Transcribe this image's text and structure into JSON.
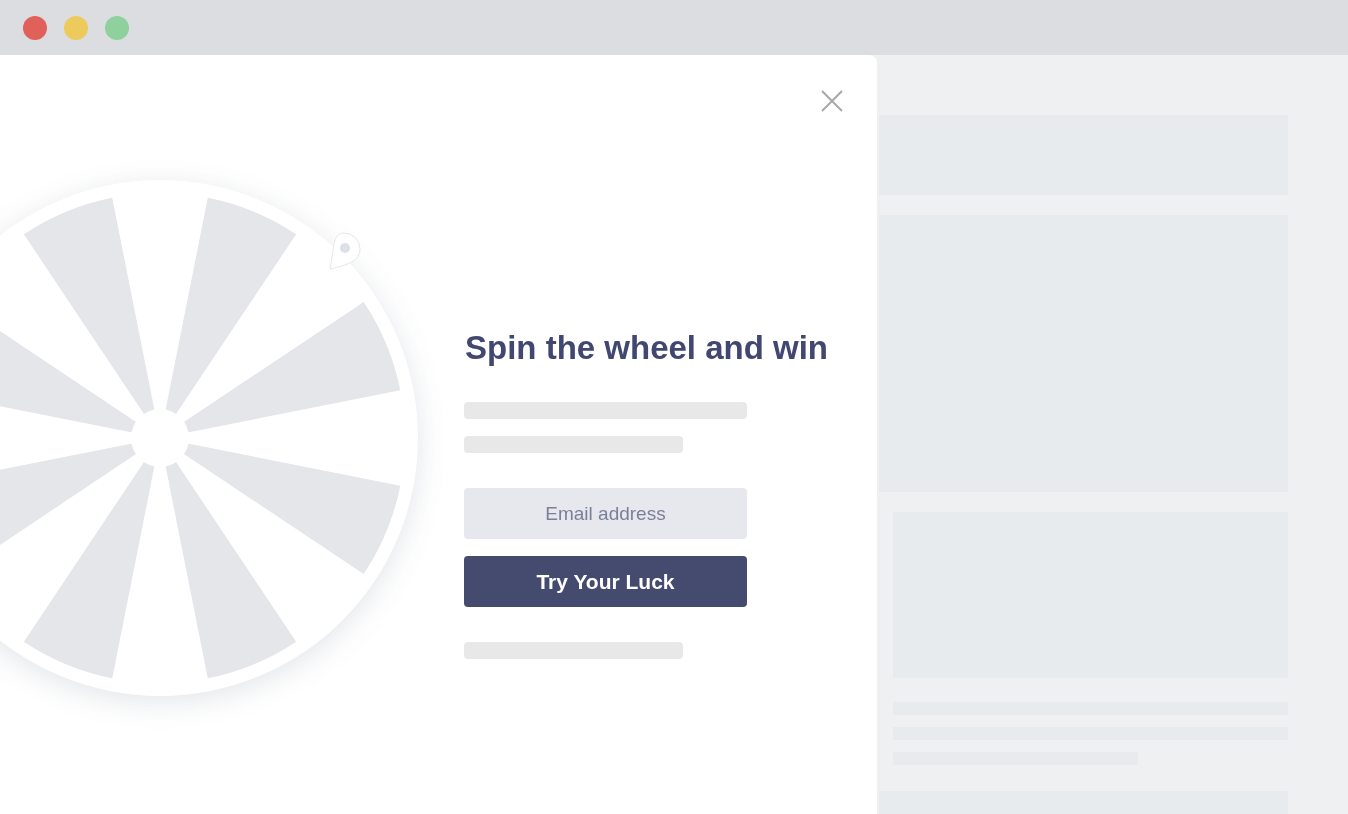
{
  "popup": {
    "title": "Spin the wheel and win",
    "email_field": {
      "placeholder": "Email address"
    },
    "button": "Try Your Luck"
  }
}
